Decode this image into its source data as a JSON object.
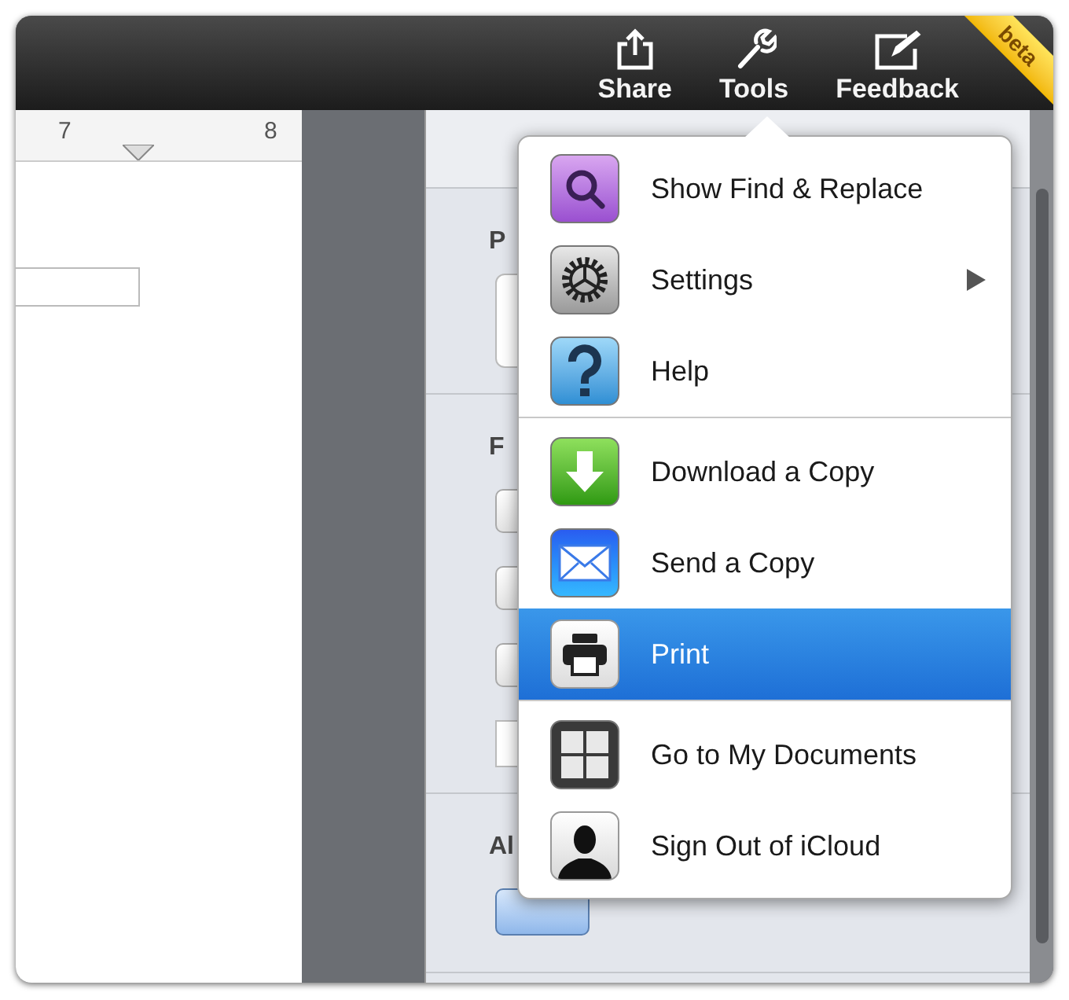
{
  "toolbar": {
    "buttons": [
      {
        "kind": "share",
        "label": "Share"
      },
      {
        "kind": "tools",
        "label": "Tools"
      },
      {
        "kind": "feedback",
        "label": "Feedback"
      }
    ],
    "ribbon": "beta"
  },
  "ruler": {
    "marks": [
      "7",
      "8"
    ]
  },
  "panel": {
    "sections": [
      {
        "heading": "P"
      },
      {
        "heading": "F",
        "controls": [
          {
            "kind": "button"
          },
          {
            "kind": "button"
          },
          {
            "kind": "button"
          },
          {
            "kind": "field"
          }
        ]
      },
      {
        "heading": "Al",
        "controls": [
          {
            "kind": "blue"
          }
        ]
      }
    ]
  },
  "menu": {
    "groups": [
      [
        {
          "kind": "search",
          "label": "Show Find & Replace",
          "selected": false,
          "submenu": false
        },
        {
          "kind": "gear",
          "label": "Settings",
          "selected": false,
          "submenu": true
        },
        {
          "kind": "help",
          "label": "Help",
          "selected": false,
          "submenu": false
        }
      ],
      [
        {
          "kind": "download",
          "label": "Download a Copy",
          "selected": false,
          "submenu": false
        },
        {
          "kind": "mail",
          "label": "Send a Copy",
          "selected": false,
          "submenu": false
        },
        {
          "kind": "print",
          "label": "Print",
          "selected": true,
          "submenu": false
        }
      ],
      [
        {
          "kind": "grid",
          "label": "Go to My Documents",
          "selected": false,
          "submenu": false
        },
        {
          "kind": "person",
          "label": "Sign Out of iCloud",
          "selected": false,
          "submenu": false
        }
      ]
    ]
  }
}
